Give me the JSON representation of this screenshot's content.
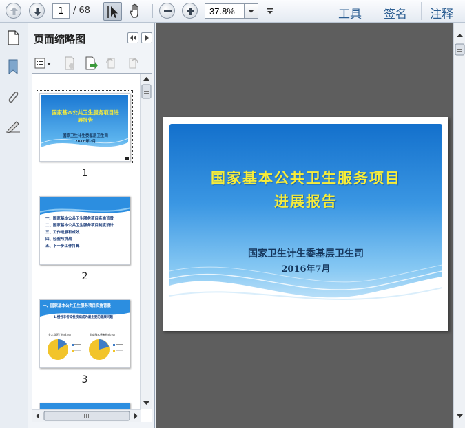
{
  "toolbar": {
    "current_page": "1",
    "total_pages": "/ 68",
    "zoom": "37.8%",
    "tools_label": "工具",
    "sign_label": "签名",
    "comment_label": "注释"
  },
  "panel": {
    "title": "页面缩略图"
  },
  "thumbnails": [
    {
      "number": "1",
      "title": "国家基本公共卫生服务项目进展报告",
      "org": "国家卫生计生委基层卫生司",
      "date": "2016年7月"
    },
    {
      "number": "2",
      "items": [
        "一、国家基本公共卫生服务项目实施背景",
        "二、国家基本公共卫生服务项目制度设计",
        "三、工作进展和成效",
        "四、经验与挑战",
        "五、下一步工作打算"
      ]
    },
    {
      "number": "3",
      "header": "一、国家基本公共卫生服务项目实施背景",
      "subheader": "1.慢性非传染性疾病成为最主要的健康问题",
      "pie_left_label": "全人群死亡构成(%)",
      "pie_right_label": "全病残疾患者构成(%)"
    }
  ],
  "slide": {
    "title_line1": "国家基本公共卫生服务项目",
    "title_line2": "进展报告",
    "org": "国家卫生计生委基层卫生司",
    "date": "2016年7月"
  },
  "colors": {
    "accent": "#2d5f93",
    "slide_title": "#f7ec3a",
    "slide_blue": "#1370cc"
  }
}
